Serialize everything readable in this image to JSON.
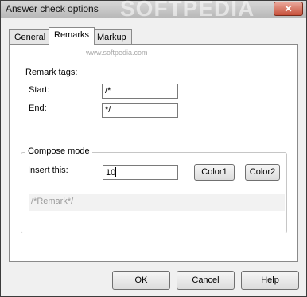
{
  "window": {
    "title": "Answer check options",
    "watermark": "SOFTPEDIA"
  },
  "tabs": [
    {
      "label": "General",
      "active": false
    },
    {
      "label": "Remarks",
      "active": true
    },
    {
      "label": "Markup",
      "active": false
    }
  ],
  "panel": {
    "url_watermark": "www.softpedia.com",
    "remark_tags_label": "Remark tags:",
    "start_label": "Start:",
    "start_value": "/*",
    "end_label": "End:",
    "end_value": "*/"
  },
  "compose": {
    "legend": "Compose mode",
    "insert_label": "Insert this:",
    "insert_value": "10",
    "color1_label": "Color1",
    "color2_label": "Color2",
    "preview_text": "/*Remark*/"
  },
  "footer": {
    "ok_label": "OK",
    "cancel_label": "Cancel",
    "help_label": "Help"
  },
  "icons": {
    "close": "close-icon"
  }
}
